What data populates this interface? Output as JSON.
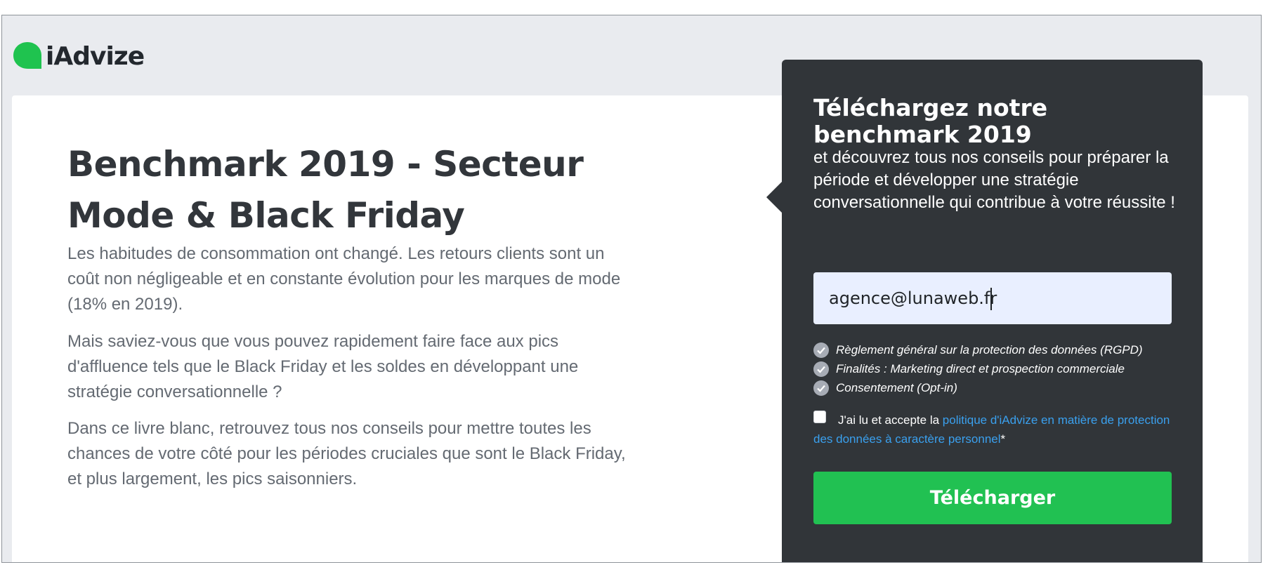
{
  "brand": {
    "name": "iAdvize",
    "accent": "#1fc34f"
  },
  "hero": {
    "title": "Benchmark 2019 - Secteur Mode & Black Friday",
    "paragraphs": [
      "Les habitudes de consommation ont changé. Les retours clients sont un coût non négligeable et en constante évolution pour les marques de mode (18% en 2019).",
      "Mais saviez-vous que vous pouvez rapidement faire face aux pics d'affluence tels que le Black Friday et les soldes en développant une stratégie conversationnelle ?",
      "Dans ce livre blanc, retrouvez tous nos conseils pour mettre toutes les chances de votre côté pour les périodes cruciales que sont le Black Friday, et plus largement, les pics saisonniers."
    ]
  },
  "form": {
    "title": "Téléchargez notre benchmark 2019",
    "subtitle": "et découvrez tous nos conseils pour préparer la période et développer une stratégie conversationnelle qui contribue à votre réussite !",
    "email_value": "agence@lunaweb.fr",
    "consents": [
      "Règlement général sur la protection des données (RGPD)",
      "Finalités : Marketing direct et prospection commerciale",
      "Consentement (Opt-in)"
    ],
    "accept_prefix": "J'ai lu et accepte la ",
    "accept_link": "politique d'iAdvize en matière de protection des données à caractère personnel",
    "accept_required": "*",
    "accept_checked": false,
    "submit_label": "Télécharger",
    "colors": {
      "panel_bg": "#313539",
      "input_bg": "#e9efff",
      "button_bg": "#21c152",
      "link": "#3aa0ee"
    }
  }
}
